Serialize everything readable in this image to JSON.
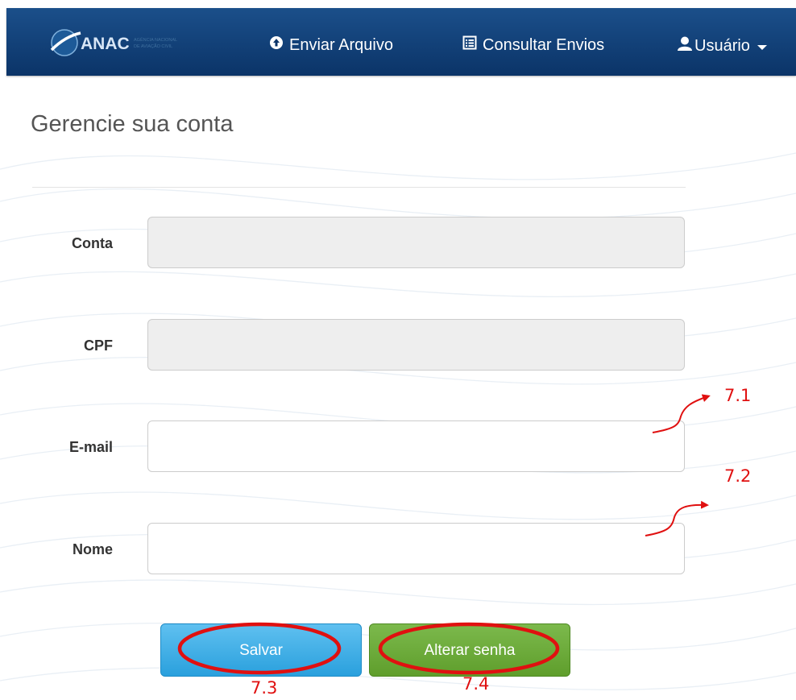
{
  "navbar": {
    "logo_text": "ANAC",
    "logo_subtext": "AGÊNCIA NACIONAL DE AVIAÇÃO CIVIL",
    "brand_color": "#0b3468",
    "items": [
      {
        "label": "Enviar Arquivo",
        "icon": "upload-circle-icon"
      },
      {
        "label": "Consultar Envios",
        "icon": "list-icon"
      },
      {
        "label": "Usuário",
        "icon": "user-icon",
        "dropdown": true
      }
    ]
  },
  "main": {
    "title": "Gerencie sua conta",
    "fields": [
      {
        "label": "Conta",
        "value": "",
        "disabled": true
      },
      {
        "label": "CPF",
        "value": "",
        "disabled": true
      },
      {
        "label": "E-mail",
        "value": "",
        "disabled": false
      },
      {
        "label": "Nome",
        "value": "",
        "disabled": false
      }
    ],
    "buttons": {
      "save_label": "Salvar",
      "save_color": "#2aa0dd",
      "change_password_label": "Alterar senha",
      "change_password_color": "#5f9e2c"
    }
  },
  "annotations": {
    "color": "#e01010",
    "labels": [
      "7.1",
      "7.2",
      "7.3",
      "7.4"
    ]
  }
}
